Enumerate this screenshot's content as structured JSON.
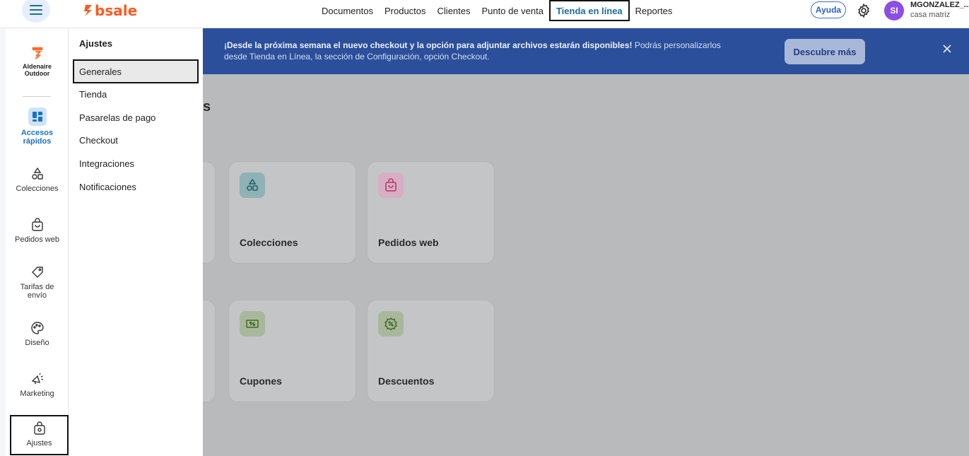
{
  "topbar": {
    "logo_text": "bsale",
    "nav": [
      "Documentos",
      "Productos",
      "Clientes",
      "Punto de venta",
      "Tienda en línea",
      "Reportes"
    ],
    "active_nav": "Tienda en línea",
    "help_label": "Ayuda",
    "user": {
      "initials": "SI",
      "name": "MGONZALEZ_...",
      "branch": "casa matriz",
      "avatar_color": "#8c4ee6"
    }
  },
  "rail": {
    "store": {
      "line1": "Aldenaire",
      "line2": "Outdoor"
    },
    "items": [
      {
        "label": "Accesos rápidos",
        "icon": "grid-icon"
      },
      {
        "label": "Colecciones",
        "icon": "shapes-icon"
      },
      {
        "label": "Pedidos web",
        "icon": "shopping-bag-icon"
      },
      {
        "label": "Tarifas de envío",
        "icon": "tag-icon"
      },
      {
        "label": "Diseño",
        "icon": "palette-icon"
      },
      {
        "label": "Marketing",
        "icon": "megaphone-icon"
      },
      {
        "label": "Ajustes",
        "icon": "bag-settings-icon"
      }
    ]
  },
  "panel": {
    "title": "Ajustes",
    "items": [
      "Generales",
      "Tienda",
      "Pasarelas de pago",
      "Checkout",
      "Integraciones",
      "Notificaciones"
    ],
    "selected": "Generales"
  },
  "banner": {
    "bold": "¡Desde la próxima semana el nuevo checkout y la opción para adjuntar archivos estarán disponibles!",
    "text": " Podrás personalizarlos desde Tienda en Línea, la sección de Configuración, opción Checkout.",
    "button": "Descubre más",
    "background": "#2b4f9a"
  },
  "main": {
    "heading_tail": "s",
    "cards": [
      {
        "label": "Colecciones",
        "icon": "shapes-icon",
        "color": "#5fa8b2"
      },
      {
        "label": "Pedidos web",
        "icon": "shopping-bag-icon",
        "color": "#e05d9c"
      },
      {
        "label": "Cupones",
        "icon": "coupon-icon",
        "color": "#6b9a4a"
      },
      {
        "label": "Descuentos",
        "icon": "discount-badge-icon",
        "color": "#6b9a4a"
      }
    ]
  }
}
